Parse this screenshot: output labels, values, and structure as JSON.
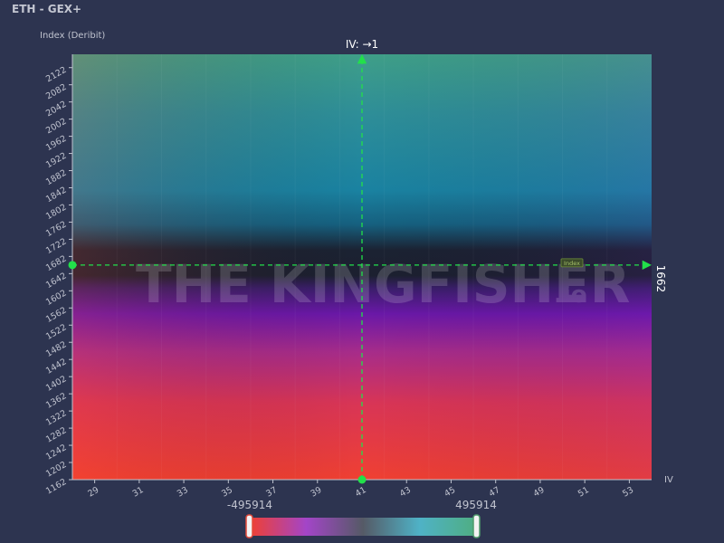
{
  "app": {
    "title": "ETH - GEX+"
  },
  "watermark": {
    "brand": "THE KINGFISHER",
    "suffix": ".io"
  },
  "colors": {
    "background": "#2d3450",
    "crosshair": "#22e04a",
    "high": "#3f9f88",
    "mid_high": "#1a82a1",
    "spot": "#1a2030",
    "mid_low": "#6a18a8",
    "low": "#f04032"
  },
  "crosshair": {
    "x_label": "IV: →1",
    "y_label": "1662",
    "tag": "Index"
  },
  "colorbar": {
    "min_label": "-495914",
    "max_label": "495914",
    "min": -495914,
    "max": 495914
  },
  "chart_data": {
    "type": "heatmap",
    "xlabel": "IV",
    "ylabel": "Index (Deribit)",
    "x_ticks": [
      29,
      31,
      33,
      35,
      37,
      39,
      41,
      43,
      45,
      47,
      49,
      51,
      53
    ],
    "y_ticks": [
      1162,
      1202,
      1242,
      1282,
      1322,
      1362,
      1402,
      1442,
      1482,
      1522,
      1562,
      1602,
      1642,
      1682,
      1722,
      1762,
      1802,
      1842,
      1882,
      1922,
      1962,
      2002,
      2042,
      2082,
      2122
    ],
    "xlim": [
      28,
      54
    ],
    "ylim": [
      1162,
      2153
    ],
    "crosshair_x": 41,
    "crosshair_y": 1662,
    "spot_level": 1662,
    "value_range": [
      -495914,
      495914
    ]
  }
}
